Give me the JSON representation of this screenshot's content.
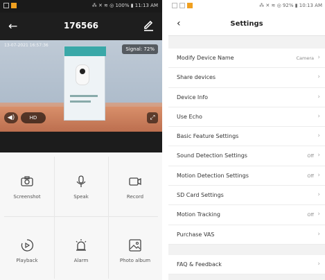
{
  "left_screen": {
    "status_bar": {
      "right": "⁂ ✕ ≋ ◎ 100% ▮ 11:13 AM"
    },
    "header": {
      "back_icon": "arrow-left-icon",
      "title": "176566",
      "edit_icon": "pencil-icon"
    },
    "video": {
      "timestamp_overlay": "13-07-2021  16:57:36",
      "signal_label": "Signal: 72%",
      "hd_label": "HD",
      "volume_icon": "speaker-icon",
      "fullscreen_icon": "fullscreen-icon"
    },
    "controls": [
      {
        "label": "Screenshot",
        "icon": "camera-icon"
      },
      {
        "label": "Speak",
        "icon": "microphone-icon"
      },
      {
        "label": "Record",
        "icon": "video-camera-icon"
      },
      {
        "label": "Playback",
        "icon": "playback-icon"
      },
      {
        "label": "Alarm",
        "icon": "alarm-light-icon"
      },
      {
        "label": "Photo album",
        "icon": "image-icon"
      }
    ]
  },
  "right_screen": {
    "status_bar": {
      "right": "⁂ ✕ ≋ ◎ 92% ▮ 10:13 AM"
    },
    "header": {
      "back_icon": "chevron-left-icon",
      "title": "Settings"
    },
    "settings": [
      {
        "label": "Modify Device Name",
        "value": "Camera"
      },
      {
        "label": "Share devices",
        "value": ""
      },
      {
        "label": "Device Info",
        "value": ""
      },
      {
        "label": "Use Echo",
        "value": ""
      },
      {
        "label": "Basic Feature Settings",
        "value": ""
      },
      {
        "label": "Sound Detection Settings",
        "value": "Off"
      },
      {
        "label": "Motion Detection Settings",
        "value": "Off"
      },
      {
        "label": "SD Card Settings",
        "value": ""
      },
      {
        "label": "Motion Tracking",
        "value": "Off"
      },
      {
        "label": "Purchase VAS",
        "value": ""
      }
    ],
    "settings_bottom": [
      {
        "label": "FAQ & Feedback",
        "value": ""
      }
    ],
    "chevron": "›"
  }
}
